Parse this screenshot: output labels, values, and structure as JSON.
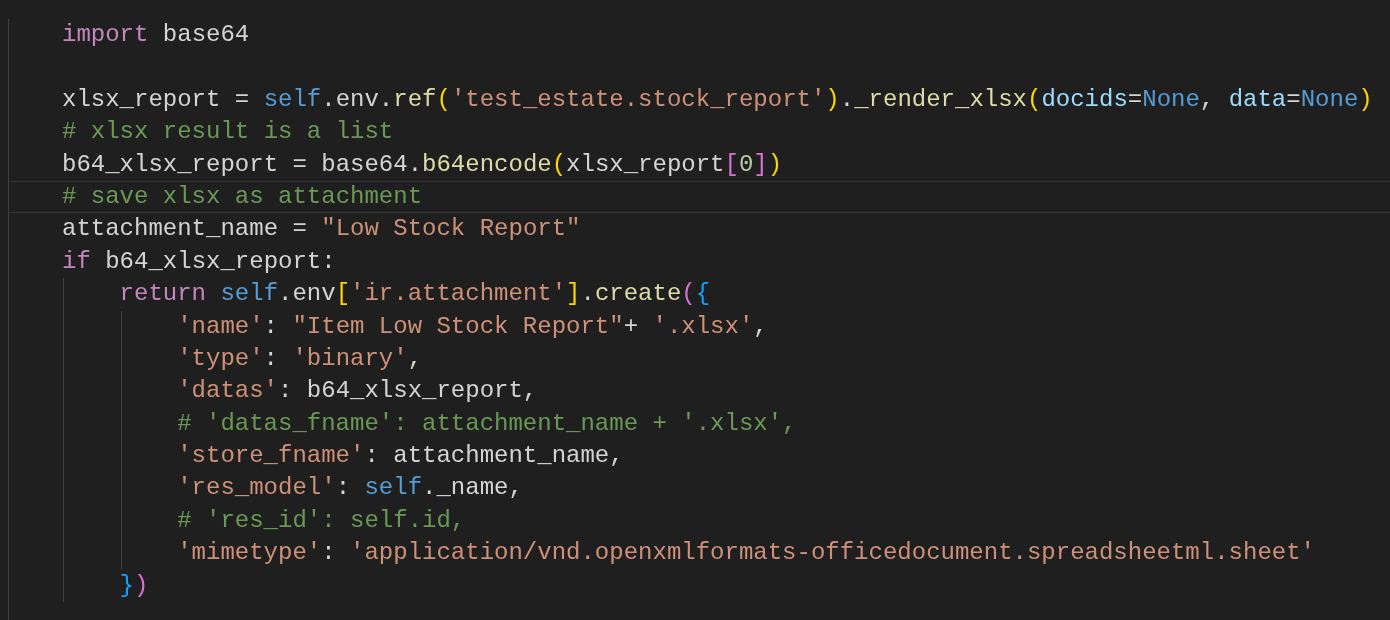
{
  "editor": {
    "lines": [
      {
        "selected": false,
        "tokens": [
          {
            "kind": "kw",
            "text": "import"
          },
          {
            "kind": "plain",
            "text": " base64"
          }
        ]
      },
      {
        "selected": false
      },
      {
        "selected": false,
        "tokens": [
          {
            "kind": "plain",
            "text": "xlsx_report = "
          },
          {
            "kind": "self",
            "text": "self"
          },
          {
            "kind": "plain",
            "text": ".env."
          },
          {
            "kind": "fn",
            "text": "ref"
          },
          {
            "kind": "b1",
            "text": "("
          },
          {
            "kind": "str",
            "text": "'test_estate.stock_report'"
          },
          {
            "kind": "b1",
            "text": ")"
          },
          {
            "kind": "plain",
            "text": "."
          },
          {
            "kind": "fn",
            "text": "_render_xlsx"
          },
          {
            "kind": "b1",
            "text": "("
          },
          {
            "kind": "param",
            "text": "docids"
          },
          {
            "kind": "plain",
            "text": "="
          },
          {
            "kind": "self",
            "text": "None"
          },
          {
            "kind": "plain",
            "text": ", "
          },
          {
            "kind": "param",
            "text": "data"
          },
          {
            "kind": "plain",
            "text": "="
          },
          {
            "kind": "self",
            "text": "None"
          },
          {
            "kind": "b1",
            "text": ")"
          }
        ]
      },
      {
        "selected": false,
        "tokens": [
          {
            "kind": "com",
            "text": "# xlsx result is a list"
          }
        ]
      },
      {
        "selected": false,
        "tokens": [
          {
            "kind": "plain",
            "text": "b64_xlsx_report = base64."
          },
          {
            "kind": "fn",
            "text": "b64encode"
          },
          {
            "kind": "b1",
            "text": "("
          },
          {
            "kind": "plain",
            "text": "xlsx_report"
          },
          {
            "kind": "b2",
            "text": "["
          },
          {
            "kind": "num",
            "text": "0"
          },
          {
            "kind": "b2",
            "text": "]"
          },
          {
            "kind": "b1",
            "text": ")"
          }
        ]
      },
      {
        "selected": true,
        "tokens": [
          {
            "kind": "com",
            "text": "# save xlsx as attachment"
          }
        ]
      },
      {
        "selected": false,
        "tokens": [
          {
            "kind": "plain",
            "text": "attachment_name = "
          },
          {
            "kind": "str",
            "text": "\"Low Stock Report\""
          }
        ]
      },
      {
        "selected": false,
        "tokens": [
          {
            "kind": "kw",
            "text": "if"
          },
          {
            "kind": "plain",
            "text": " b64_xlsx_report:"
          }
        ],
        "children": [
          {
            "selected": false,
            "tokens": [
              {
                "kind": "kw",
                "text": "return "
              },
              {
                "kind": "self",
                "text": "self"
              },
              {
                "kind": "plain",
                "text": ".env"
              },
              {
                "kind": "b1",
                "text": "["
              },
              {
                "kind": "str",
                "text": "'ir.attachment'"
              },
              {
                "kind": "b1",
                "text": "]"
              },
              {
                "kind": "plain",
                "text": "."
              },
              {
                "kind": "fn",
                "text": "create"
              },
              {
                "kind": "b2",
                "text": "("
              },
              {
                "kind": "b3",
                "text": "{"
              }
            ],
            "children": [
              {
                "selected": false,
                "tokens": [
                  {
                    "kind": "str",
                    "text": "'name'"
                  },
                  {
                    "kind": "plain",
                    "text": ": "
                  },
                  {
                    "kind": "str",
                    "text": "\"Item Low Stock Report\""
                  },
                  {
                    "kind": "plain",
                    "text": "+ "
                  },
                  {
                    "kind": "str",
                    "text": "'.xlsx'"
                  },
                  {
                    "kind": "plain",
                    "text": ","
                  }
                ]
              },
              {
                "selected": false,
                "tokens": [
                  {
                    "kind": "str",
                    "text": "'type'"
                  },
                  {
                    "kind": "plain",
                    "text": ": "
                  },
                  {
                    "kind": "str",
                    "text": "'binary'"
                  },
                  {
                    "kind": "plain",
                    "text": ","
                  }
                ]
              },
              {
                "selected": false,
                "tokens": [
                  {
                    "kind": "str",
                    "text": "'datas'"
                  },
                  {
                    "kind": "plain",
                    "text": ": b64_xlsx_report,"
                  }
                ]
              },
              {
                "selected": false,
                "tokens": [
                  {
                    "kind": "com",
                    "text": "# 'datas_fname': attachment_name + '.xlsx',"
                  }
                ]
              },
              {
                "selected": false,
                "tokens": [
                  {
                    "kind": "str",
                    "text": "'store_fname'"
                  },
                  {
                    "kind": "plain",
                    "text": ": attachment_name,"
                  }
                ]
              },
              {
                "selected": false,
                "tokens": [
                  {
                    "kind": "str",
                    "text": "'res_model'"
                  },
                  {
                    "kind": "plain",
                    "text": ": "
                  },
                  {
                    "kind": "self",
                    "text": "self"
                  },
                  {
                    "kind": "plain",
                    "text": "._name,"
                  }
                ]
              },
              {
                "selected": false,
                "tokens": [
                  {
                    "kind": "com",
                    "text": "# 'res_id': self.id,"
                  }
                ]
              },
              {
                "selected": false,
                "tokens": [
                  {
                    "kind": "str",
                    "text": "'mimetype'"
                  },
                  {
                    "kind": "plain",
                    "text": ": "
                  },
                  {
                    "kind": "str",
                    "text": "'application/vnd.openxmlformats-officedocument.spreadsheetml.sheet'"
                  }
                ]
              }
            ]
          },
          {
            "selected": false,
            "tokens": [
              {
                "kind": "b3",
                "text": "}"
              },
              {
                "kind": "b2",
                "text": ")"
              }
            ]
          }
        ]
      }
    ]
  }
}
